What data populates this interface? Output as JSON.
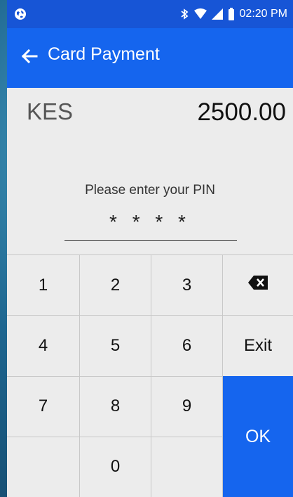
{
  "status_bar": {
    "time": "02:20 PM",
    "icons": [
      "globe-icon",
      "bluetooth-icon",
      "wifi-icon",
      "signal-icon",
      "battery-icon"
    ]
  },
  "app_bar": {
    "title": "Card Payment",
    "back_icon": "arrow-left-icon"
  },
  "payment": {
    "currency": "KES",
    "amount": "2500.00"
  },
  "pin_entry": {
    "prompt": "Please enter your PIN",
    "masked_value": "* * * *"
  },
  "keypad": {
    "keys": [
      "1",
      "2",
      "3",
      "4",
      "5",
      "6",
      "7",
      "8",
      "9",
      "0"
    ],
    "backspace_icon": "backspace-icon",
    "exit_label": "Exit",
    "ok_label": "OK"
  },
  "colors": {
    "status_bar": "#1755d6",
    "app_bar": "#1565ee",
    "ok_button": "#1565ee",
    "screen_background": "#ececec"
  }
}
